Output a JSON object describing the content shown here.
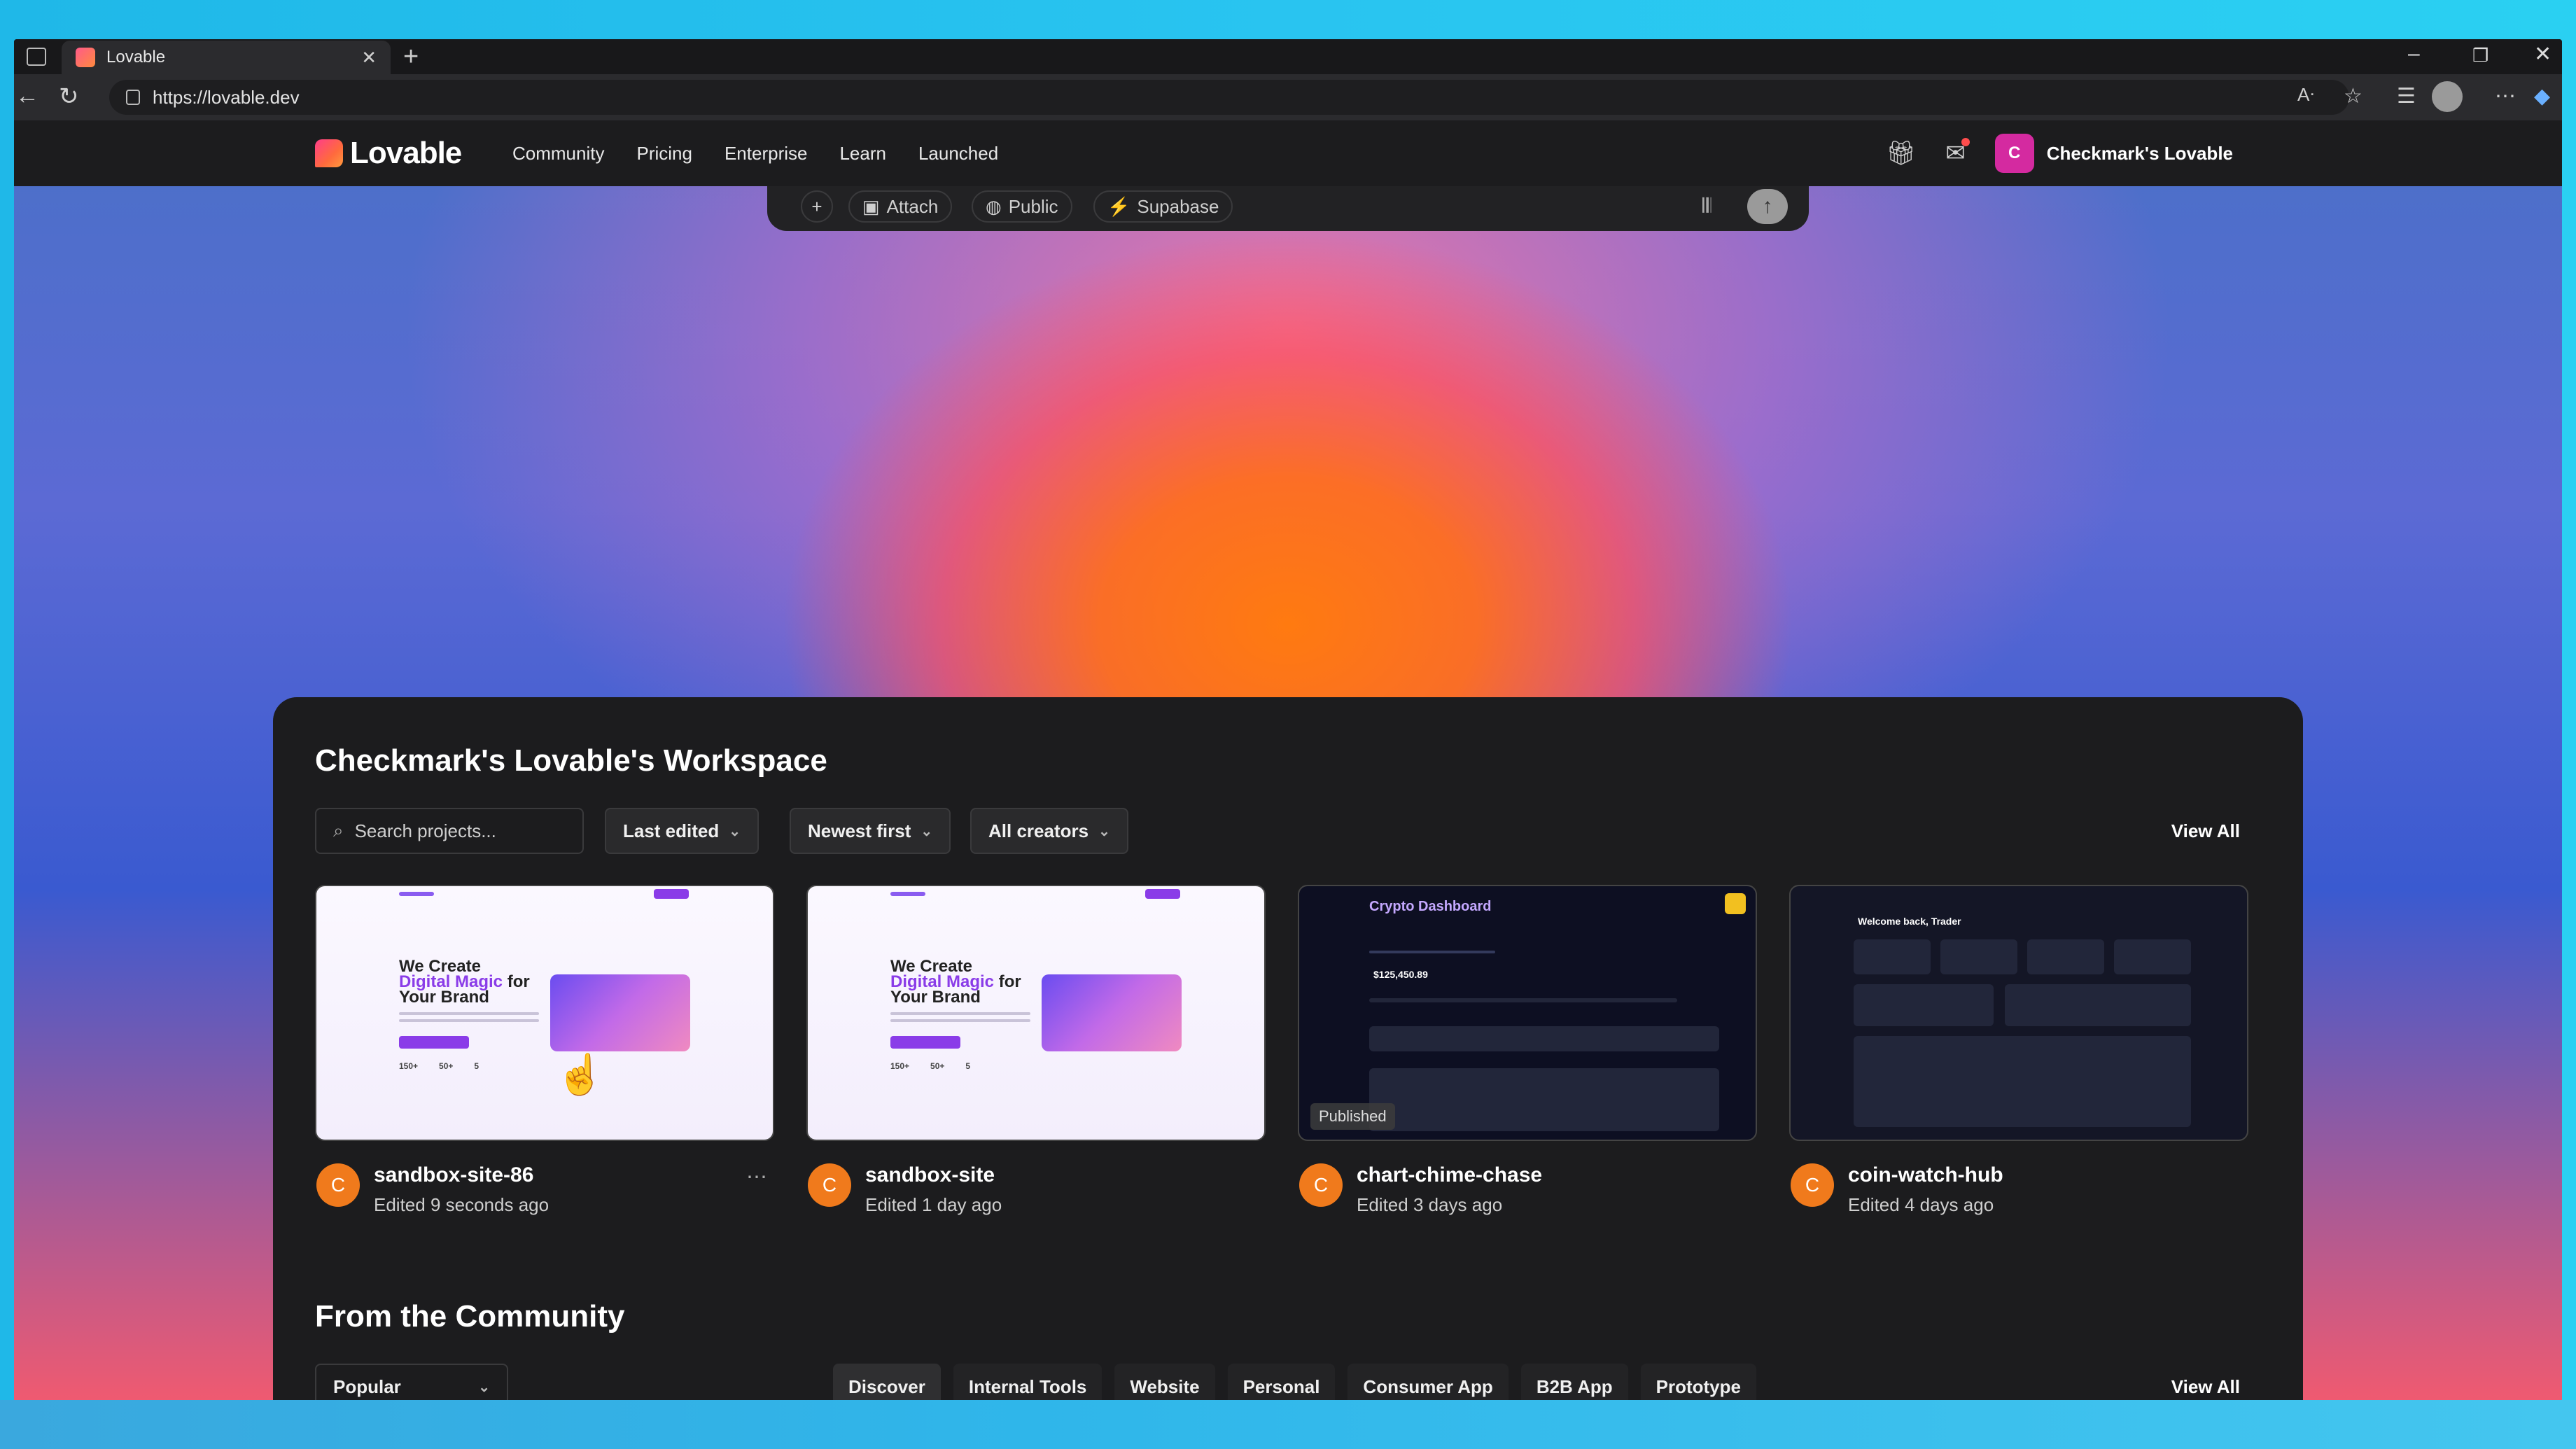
{
  "browser": {
    "tab_title": "Lovable",
    "url": "https://lovable.dev"
  },
  "site_nav": {
    "logo": "Lovable",
    "menu": [
      "Community",
      "Pricing",
      "Enterprise",
      "Learn",
      "Launched"
    ],
    "account_initial": "C",
    "account_name": "Checkmark's Lovable"
  },
  "prompt_bar": {
    "attach": "Attach",
    "public": "Public",
    "supabase": "Supabase"
  },
  "workspace": {
    "title": "Checkmark's Lovable's Workspace",
    "search_placeholder": "Search projects...",
    "filters": [
      "Last edited",
      "Newest first",
      "All creators"
    ],
    "view_all": "View All",
    "projects": [
      {
        "name": "sandbox-site-86",
        "edited": "Edited 9 seconds ago",
        "initial": "C",
        "thumb_headline_1": "We Create",
        "thumb_headline_2": "Digital Magic",
        "thumb_headline_3": "for Your Brand",
        "thumb_stats": [
          "150+",
          "50+",
          "5"
        ]
      },
      {
        "name": "sandbox-site",
        "edited": "Edited 1 day ago",
        "initial": "C",
        "thumb_headline_1": "We Create",
        "thumb_headline_2": "Digital Magic",
        "thumb_headline_3": "for Your Brand",
        "thumb_stats": [
          "150+",
          "50+",
          "5"
        ]
      },
      {
        "name": "chart-chime-chase",
        "edited": "Edited 3 days ago",
        "initial": "C",
        "thumb_title": "Crypto Dashboard",
        "thumb_value": "$125,450.89",
        "badge": "Published"
      },
      {
        "name": "coin-watch-hub",
        "edited": "Edited 4 days ago",
        "initial": "C",
        "thumb_title": "Welcome back, Trader"
      }
    ]
  },
  "community": {
    "title": "From the Community",
    "sort": "Popular",
    "categories": [
      "Discover",
      "Internal Tools",
      "Website",
      "Personal",
      "Consumer App",
      "B2B App",
      "Prototype"
    ],
    "view_all": "View All"
  }
}
